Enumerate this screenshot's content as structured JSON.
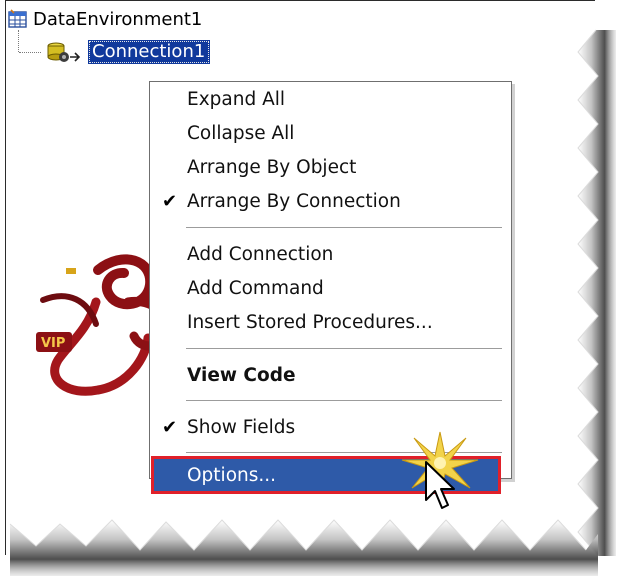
{
  "tree": {
    "root_label": "DataEnvironment1",
    "root_icon": "data-environment-icon",
    "child_label": "Connection1",
    "child_icon": "connection-icon",
    "selection_color": "#10399c"
  },
  "context_menu": {
    "items": [
      {
        "label": "Expand All",
        "checked": false
      },
      {
        "label": "Collapse All",
        "checked": false
      },
      {
        "label": "Arrange By Object",
        "checked": false
      },
      {
        "label": "Arrange By Connection",
        "checked": true
      },
      {
        "label": "Add Connection",
        "checked": false
      },
      {
        "label": "Add Command",
        "checked": false
      },
      {
        "label": "Insert Stored Procedures...",
        "checked": false
      },
      {
        "label": "View Code",
        "checked": false,
        "bold": true
      },
      {
        "label": "Show Fields",
        "checked": true
      },
      {
        "label": "Options...",
        "checked": false,
        "highlighted": true
      }
    ],
    "check_glyph": "✔",
    "highlight_color": "#2e5aa8",
    "highlight_outline_color": "#e0202a"
  },
  "logo": {
    "text": "VIP",
    "icon": "vip-99-logo"
  },
  "cursor": {
    "icon": "arrow-cursor-icon"
  }
}
